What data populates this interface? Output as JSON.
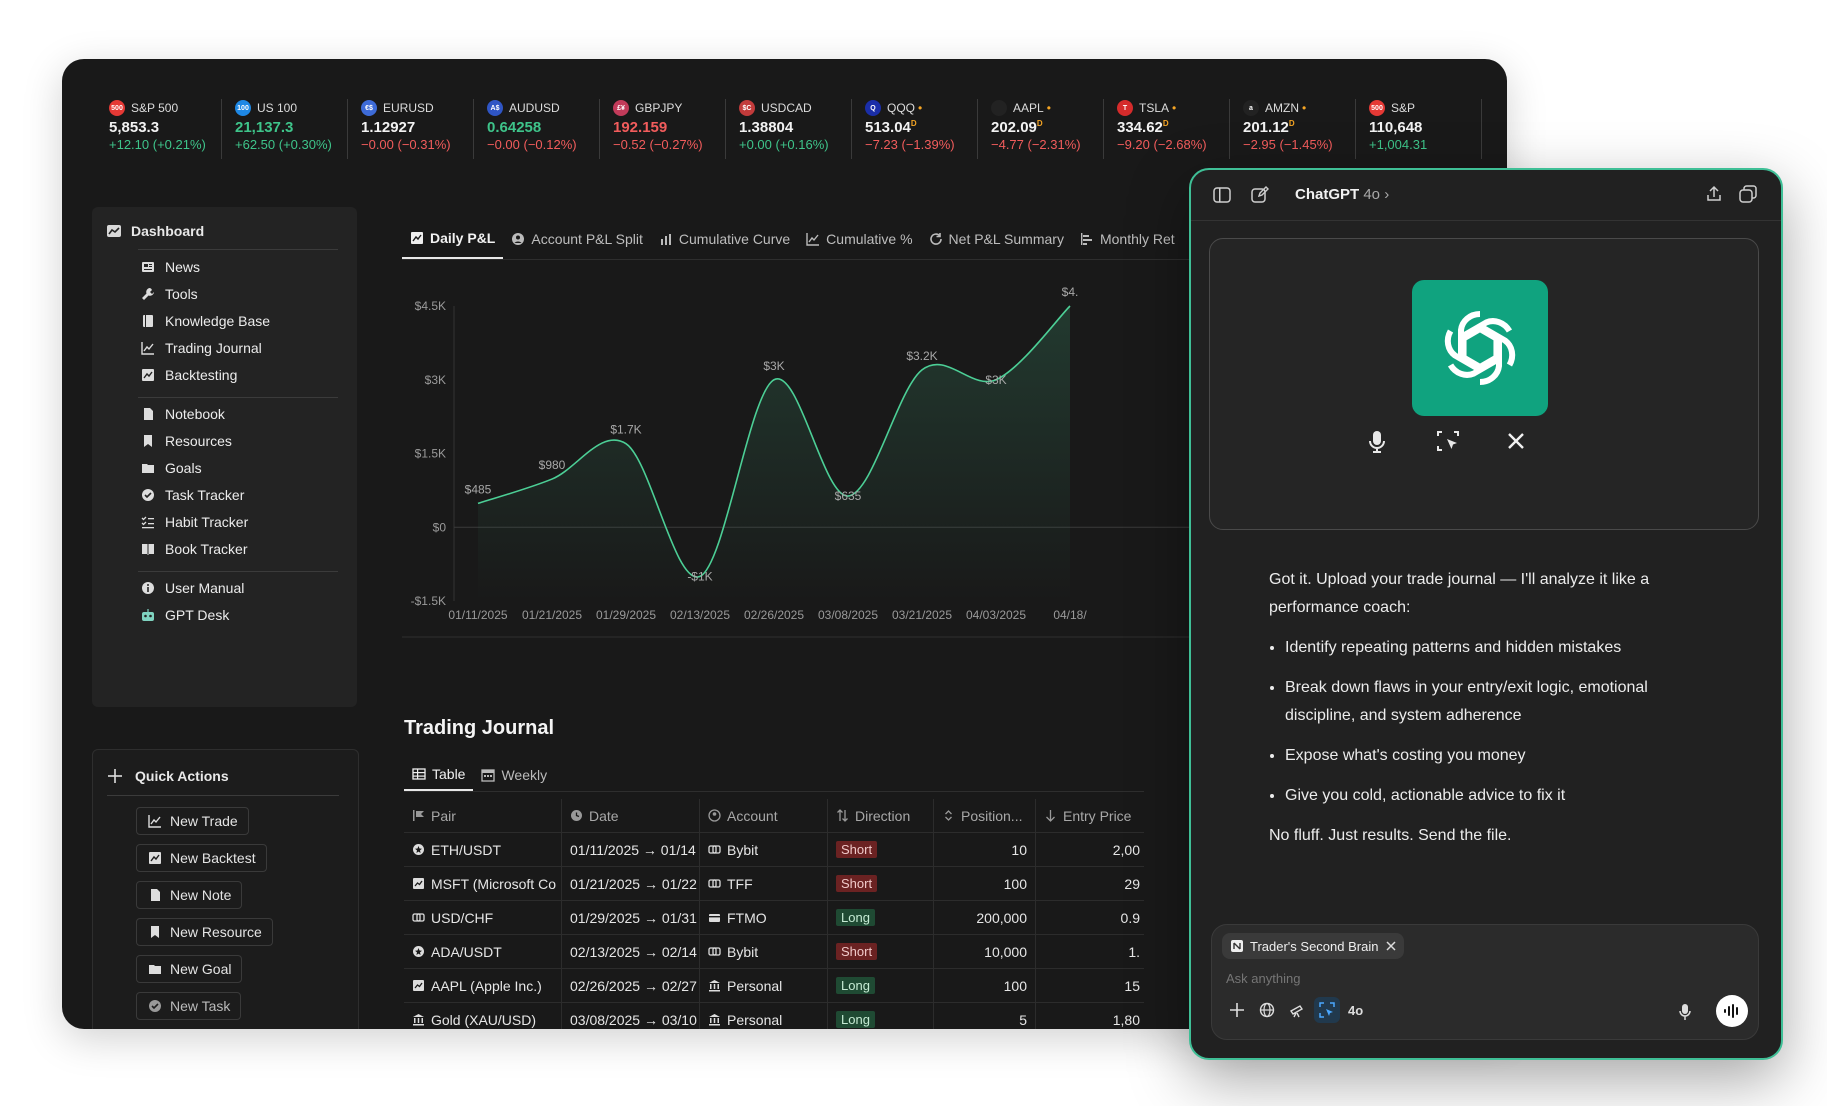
{
  "ticker": [
    {
      "badge": "500",
      "badge_color": "#e53935",
      "name": "S&P 500",
      "price": "5,853.3",
      "change": "+12.10 (+0.21%)",
      "dir": "up",
      "price_color": "white"
    },
    {
      "badge": "100",
      "badge_color": "#1e88e5",
      "name": "US 100",
      "price": "21,137.3",
      "change": "+62.50 (+0.30%)",
      "dir": "up",
      "price_color": "green"
    },
    {
      "badge": "€$",
      "badge_color": "#3d6bd8",
      "name": "EURUSD",
      "price": "1.12927",
      "change": "−0.00 (−0.31%)",
      "dir": "down",
      "price_color": "white"
    },
    {
      "badge": "A$",
      "badge_color": "#2f55c4",
      "name": "AUDUSD",
      "price": "0.64258",
      "change": "−0.00 (−0.12%)",
      "dir": "down",
      "price_color": "green"
    },
    {
      "badge": "£¥",
      "badge_color": "#c23b5a",
      "name": "GBPJPY",
      "price": "192.159",
      "change": "−0.52 (−0.27%)",
      "dir": "down",
      "price_color": "red"
    },
    {
      "badge": "$C",
      "badge_color": "#c23b3b",
      "name": "USDCAD",
      "price": "1.38804",
      "change": "+0.00 (+0.16%)",
      "dir": "up",
      "price_color": "white"
    },
    {
      "badge": "Q",
      "badge_color": "#1a2ea8",
      "name": "QQQ",
      "price": "513.04",
      "change": "−7.23 (−1.39%)",
      "dir": "down",
      "price_color": "white",
      "flag": "D"
    },
    {
      "badge": "",
      "badge_color": "#222",
      "name": "AAPL",
      "price": "202.09",
      "change": "−4.77 (−2.31%)",
      "dir": "down",
      "price_color": "white",
      "flag": "D"
    },
    {
      "badge": "T",
      "badge_color": "#d52b2b",
      "name": "TSLA",
      "price": "334.62",
      "change": "−9.20 (−2.68%)",
      "dir": "down",
      "price_color": "white",
      "flag": "D"
    },
    {
      "badge": "a",
      "badge_color": "#222",
      "name": "AMZN",
      "price": "201.12",
      "change": "−2.95 (−1.45%)",
      "dir": "down",
      "price_color": "white",
      "flag": "D"
    },
    {
      "badge": "500",
      "badge_color": "#e53935",
      "name": "S&P",
      "price": "110,648",
      "change": "+1,004.31",
      "dir": "up",
      "price_color": "white"
    }
  ],
  "sidebar": {
    "header": "Dashboard",
    "items": [
      "News",
      "Tools",
      "Knowledge Base",
      "Trading Journal",
      "Backtesting",
      "Notebook",
      "Resources",
      "Goals",
      "Task Tracker",
      "Habit Tracker",
      "Book Tracker",
      "User Manual",
      "GPT Desk"
    ]
  },
  "quick_actions": {
    "header": "Quick Actions",
    "buttons": [
      "New Trade",
      "New Backtest",
      "New Note",
      "New Resource",
      "New Goal",
      "New Task"
    ]
  },
  "tabs": [
    "Daily P&L",
    "Account P&L Split",
    "Cumulative Curve",
    "Cumulative %",
    "Net P&L Summary",
    "Monthly Ret"
  ],
  "chart_data": {
    "type": "area",
    "x": [
      "01/11/2025",
      "01/21/2025",
      "01/29/2025",
      "02/13/2025",
      "02/26/2025",
      "03/08/2025",
      "03/21/2025",
      "04/03/2025",
      "04/18/"
    ],
    "series": [
      {
        "values": [
          485,
          980,
          1700,
          -1000,
          3000,
          635,
          3200,
          3000,
          4500
        ]
      }
    ],
    "point_labels": [
      "$485",
      "$980",
      "$1.7K",
      "-$1K",
      "$3K",
      "$635",
      "$3.2K",
      "$3K",
      "$4."
    ],
    "y_ticks": [
      "$4.5K",
      "$3K",
      "$1.5K",
      "$0",
      "-$1.5K"
    ],
    "ylim": [
      -1500,
      4500
    ],
    "line_color": "#4ccf96"
  },
  "journal": {
    "title": "Trading Journal",
    "tabs": [
      "Table",
      "Weekly"
    ],
    "columns": [
      "Pair",
      "Date",
      "Account",
      "Direction",
      "Position...",
      "Entry Price"
    ],
    "rows": [
      {
        "pair": "ETH/USDT",
        "date": "01/11/2025 → 01/14",
        "account": "Bybit",
        "direction": "Short",
        "position": "10",
        "entry": "2,00"
      },
      {
        "pair": "MSFT (Microsoft Co",
        "date": "01/21/2025 → 01/22",
        "account": "TFF",
        "direction": "Short",
        "position": "100",
        "entry": "29"
      },
      {
        "pair": "USD/CHF",
        "date": "01/29/2025 → 01/31",
        "account": "FTMO",
        "direction": "Long",
        "position": "200,000",
        "entry": "0.9"
      },
      {
        "pair": "ADA/USDT",
        "date": "02/13/2025 → 02/14",
        "account": "Bybit",
        "direction": "Short",
        "position": "10,000",
        "entry": "1."
      },
      {
        "pair": "AAPL (Apple Inc.)",
        "date": "02/26/2025 → 02/27",
        "account": "Personal",
        "direction": "Long",
        "position": "100",
        "entry": "15"
      },
      {
        "pair": "Gold (XAU/USD)",
        "date": "03/08/2025 → 03/10",
        "account": "Personal",
        "direction": "Long",
        "position": "5",
        "entry": "1,80"
      }
    ]
  },
  "gpt": {
    "title": "ChatGPT",
    "model": "4o ›",
    "intro": "Got it. Upload your trade journal — I'll analyze it like a performance coach:",
    "bullets": [
      "Identify repeating patterns and hidden mistakes",
      "Break down flaws in your entry/exit logic, emotional discipline, and system adherence",
      "Expose what's costing you money",
      "Give you cold, actionable advice to fix it"
    ],
    "outro": "No fluff. Just results. Send the file.",
    "chip": "Trader's Second Brain",
    "placeholder": "Ask anything",
    "model_small": "4o",
    "accent": "#10a37f"
  }
}
